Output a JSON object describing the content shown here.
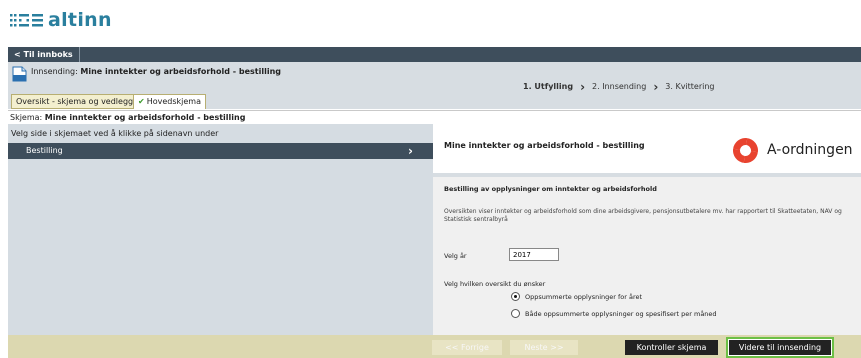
{
  "brand": {
    "name": "altinn"
  },
  "topbar": {
    "back_label": "< Til innboks"
  },
  "header": {
    "submission_prefix": "Innsending:",
    "submission_name": "Mine inntekter og arbeidsforhold - bestilling",
    "steps": [
      "1. Utfylling",
      "2. Innsending",
      "3. Kvittering"
    ]
  },
  "tabs": {
    "overview": "Oversikt - skjema og vedlegg",
    "main": "Hovedskjema"
  },
  "schema": {
    "prefix": "Skjema:",
    "name": "Mine inntekter og arbeidsforhold - bestilling"
  },
  "left": {
    "hint": "Velg side i skjemaet ved å klikke på sidenavn under",
    "items": [
      {
        "label": "Bestilling"
      }
    ]
  },
  "form": {
    "title": "Mine inntekter og arbeidsforhold - bestilling",
    "logo_text": "A-ordningen",
    "section_title": "Bestilling av opplysninger om inntekter og arbeidsforhold",
    "description": "Oversikten viser inntekter og arbeidsforhold som dine arbeidsgivere, pensjonsutbetalere mv. har rapportert til Skatteetaten, NAV og Statistisk sentralbyrå",
    "year_label": "Velg år",
    "year_value": "2017",
    "choice_label": "Velg hvilken oversikt du ønsker",
    "options": [
      {
        "label": "Oppsummerte opplysninger for året",
        "selected": true
      },
      {
        "label": "Både oppsummerte opplysninger og spesifisert per måned",
        "selected": false
      }
    ]
  },
  "footer": {
    "prev": "<< Forrige",
    "next": "Neste >>",
    "validate": "Kontroller skjema",
    "submit": "Videre til innsending"
  },
  "colors": {
    "dark_bar": "#3e4e5c",
    "band": "#d7dde2",
    "footer": "#dcd8b0",
    "brand": "#2a7f9e",
    "a_logo": "#e8432f",
    "highlight": "#6cbf45"
  }
}
